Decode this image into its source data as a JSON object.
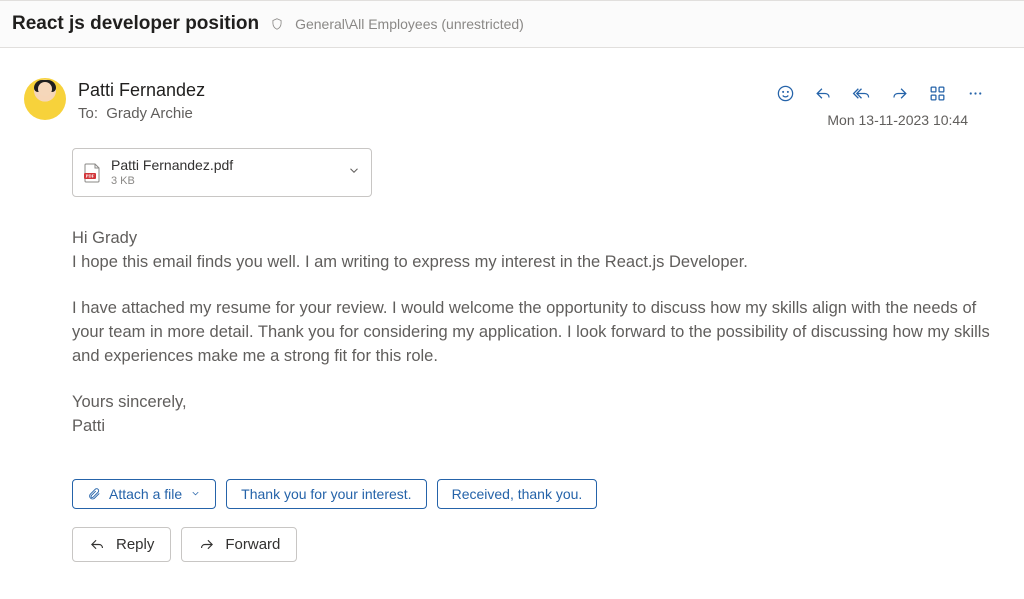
{
  "subject": "React js developer position",
  "classification": "General\\All Employees (unrestricted)",
  "sender": {
    "name": "Patti Fernandez"
  },
  "recipient": {
    "to_label": "To:",
    "name": "Grady Archie"
  },
  "timestamp": "Mon 13-11-2023 10:44",
  "attachment": {
    "name": "Patti Fernandez.pdf",
    "size": "3 KB"
  },
  "body": {
    "p1a": "Hi Grady",
    "p1b": "I hope this email finds you well. I am writing to express my interest in the React.js Developer.",
    "p2": "I have attached my resume for your review. I would welcome the opportunity to discuss how my skills align with the needs of your team in more detail. Thank you for considering my application. I look forward to the possibility of discussing how my skills and experiences make me a strong fit for this role.",
    "p3a": "Yours sincerely,",
    "p3b": "Patti"
  },
  "suggestions": {
    "attach": "Attach a file",
    "reply1": "Thank you for your interest.",
    "reply2": "Received, thank you."
  },
  "actions": {
    "reply": "Reply",
    "forward": "Forward"
  },
  "icons": {
    "shield": "shield-icon",
    "react": "smile-icon",
    "reply": "reply-icon",
    "reply_all": "reply-all-icon",
    "forward": "forward-arrow-icon",
    "apps": "apps-icon",
    "more": "more-icon",
    "pdf": "pdf-icon",
    "chevron_down": "chevron-down-icon",
    "paperclip": "paperclip-icon"
  },
  "colors": {
    "accent": "#2563a9"
  }
}
